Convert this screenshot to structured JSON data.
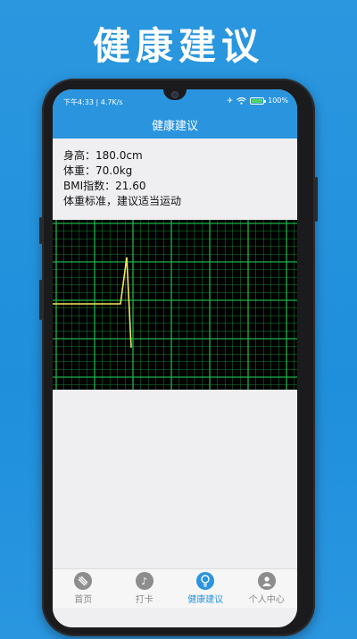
{
  "promo": {
    "title": "健康建议"
  },
  "status_bar": {
    "time_speed": "下午4:33 | 4.7K/s",
    "battery_text": "100%"
  },
  "header": {
    "title": "健康建议"
  },
  "info": {
    "height": "身高：180.0cm",
    "weight": "体重：70.0kg",
    "bmi": "BMI指数：21.60",
    "advice": "体重标准，建议适当运动"
  },
  "tabs": [
    {
      "label": "首页",
      "icon": "tag-icon",
      "active": false
    },
    {
      "label": "打卡",
      "icon": "music-note-icon",
      "active": false
    },
    {
      "label": "健康建议",
      "icon": "lightbulb-icon",
      "active": true
    },
    {
      "label": "个人中心",
      "icon": "user-icon",
      "active": false
    }
  ],
  "colors": {
    "brand": "#2a95de",
    "grid": "#1db24a",
    "trace": "#f2e85a"
  }
}
